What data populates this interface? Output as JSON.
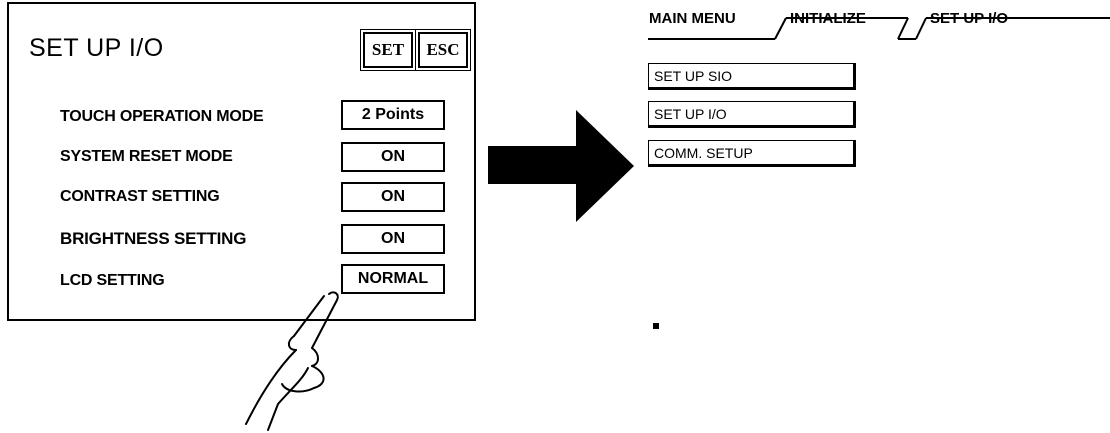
{
  "panel": {
    "title": "SET UP I/O",
    "set_label": "SET",
    "esc_label": "ESC",
    "rows": [
      {
        "label": "TOUCH OPERATION MODE",
        "value": "2 Points"
      },
      {
        "label": "SYSTEM RESET MODE",
        "value": "ON"
      },
      {
        "label": "CONTRAST SETTING",
        "value": "ON"
      },
      {
        "label": "BRIGHTNESS SETTING",
        "value": "ON"
      },
      {
        "label": "LCD SETTING",
        "value": "NORMAL"
      }
    ]
  },
  "menu": {
    "breadcrumb": [
      "MAIN MENU",
      "INITIALIZE",
      "SET UP I/O"
    ],
    "items": [
      "SET UP SIO",
      "SET UP I/O",
      "COMM. SETUP"
    ]
  },
  "icons": {
    "arrow": "right-arrow-icon",
    "hand": "pointing-hand-icon"
  }
}
